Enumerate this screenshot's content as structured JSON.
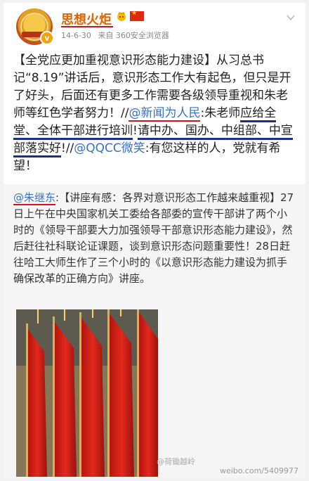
{
  "header": {
    "username": "思想火炬",
    "date": "14-6-30",
    "source": "来自 360安全浏览器",
    "verified_badge": "v"
  },
  "post": {
    "seg1": "【全党应更加重视意识形态能力建设】从习总书记“8.19”讲话后，意识形态工作大有起色，但只是开了好头，后面还有更多工作需要各级领导重视和朱老师等红色学者努力！//",
    "mention1": "@新闻为人民",
    "seg2": ":朱老师",
    "seg3": "应给全堂、全体干部进行培训",
    "seg4": "!",
    "seg5": "请中办、国办、中组部、中宣部落实好",
    "seg6": "!//",
    "mention2": "@QQCC微笑",
    "seg7": ":有您这样的人，党就有希望！"
  },
  "repost": {
    "mention": "@朱继东",
    "text": ":【讲座有感：各界对意识形态工作越来越重视】27日上午在中央国家机关工委给各部委的宣传干部讲了两个小时的《领导干部要大力加强领导干部意识形态能力建设》，然后赶往社科联论证课题，谈到意识形态问题重要性！28日赶往哈工大师生作了三个小时的《以意识形态能力建设为抓手确保改革的正确方向》讲座。"
  },
  "watermarks": {
    "w1": "@荷锄越岭",
    "w2": "weibo.com/5409977"
  },
  "icons": {
    "crown": "crown-emoji-icon",
    "flag": "china-flag-icon",
    "chevron": "chevron-down-icon"
  },
  "colors": {
    "username": "#e86100",
    "mention": "#3a70c7",
    "flag_red": "#d4231b",
    "underline_red": "#d0161b",
    "underline_blue": "#1a2f8a"
  }
}
